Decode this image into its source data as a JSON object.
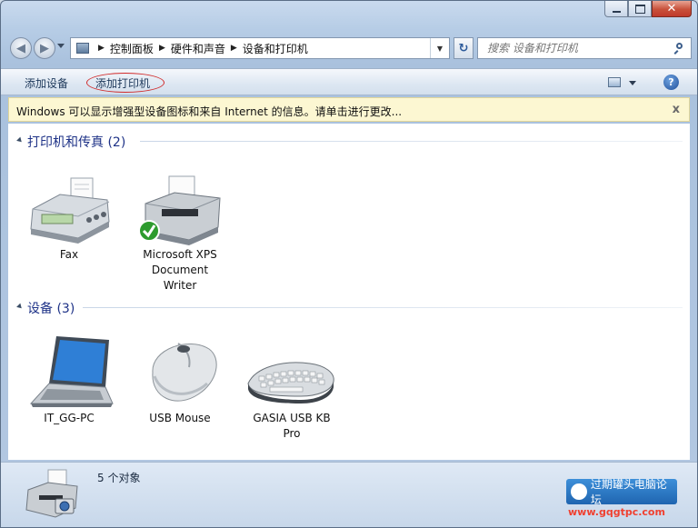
{
  "window": {
    "caption_buttons": {
      "minimize": "minimize-icon",
      "maximize": "maximize-icon",
      "close": "✕"
    }
  },
  "nav": {
    "breadcrumb": [
      "控制面板",
      "硬件和声音",
      "设备和打印机"
    ],
    "search_placeholder": "搜索 设备和打印机"
  },
  "toolbar": {
    "add_device": "添加设备",
    "add_printer": "添加打印机",
    "highlight_color": "#d12a2a"
  },
  "infobar": {
    "message": "Windows 可以显示增强型设备图标和来自 Internet 的信息。请单击进行更改...",
    "close": "x"
  },
  "groups": {
    "printers": {
      "title": "打印机和传真 (2)",
      "items": [
        {
          "name": "Fax",
          "icon": "fax-icon"
        },
        {
          "name": "Microsoft XPS Document Writer",
          "icon": "printer-default-icon"
        }
      ]
    },
    "devices": {
      "title": "设备 (3)",
      "items": [
        {
          "name": "IT_GG-PC",
          "icon": "laptop-icon"
        },
        {
          "name": "USB Mouse",
          "icon": "mouse-icon"
        },
        {
          "name": "GASIA USB KB Pro",
          "icon": "keyboard-icon"
        }
      ]
    }
  },
  "status": {
    "count": "5 个对象"
  },
  "watermark": {
    "text": "过期罐头电脑论坛",
    "url": "www.gqgtpc.com"
  }
}
